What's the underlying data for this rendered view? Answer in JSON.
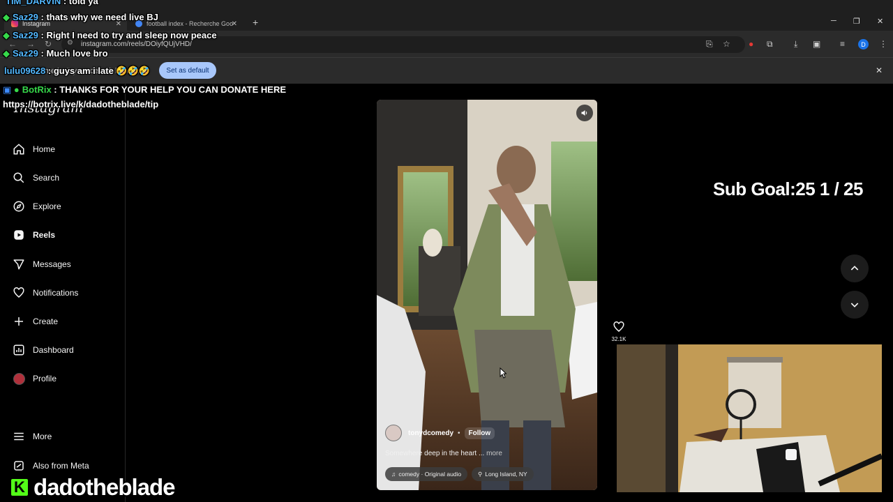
{
  "browser": {
    "tabs": [
      {
        "title": "Instagram",
        "active": true
      },
      {
        "title": "football index - Recherche Goo",
        "active": false
      }
    ],
    "new_tab": "+",
    "url": "instagram.com/reels/DOiyfQUjVHD/",
    "profile_initial": "D",
    "infobar": {
      "text": "Chrome isn't your default browser",
      "button": "Set as default",
      "close": "✕"
    },
    "window_controls": [
      "─",
      "❐",
      "✕"
    ]
  },
  "instagram": {
    "logo": "Instagram",
    "nav": [
      {
        "label": "Home",
        "icon": "home-icon"
      },
      {
        "label": "Search",
        "icon": "search-icon"
      },
      {
        "label": "Explore",
        "icon": "compass-icon"
      },
      {
        "label": "Reels",
        "icon": "reels-icon",
        "active": true
      },
      {
        "label": "Messages",
        "icon": "messages-icon"
      },
      {
        "label": "Notifications",
        "icon": "heart-icon"
      },
      {
        "label": "Create",
        "icon": "plus-icon"
      },
      {
        "label": "Dashboard",
        "icon": "dashboard-icon"
      },
      {
        "label": "Profile",
        "icon": "avatar"
      },
      {
        "label": "More",
        "icon": "menu-icon"
      },
      {
        "label": "Also from Meta",
        "icon": "meta-icon"
      }
    ],
    "reel": {
      "author": "tonydcomedy",
      "separator": "•",
      "follow": "Follow",
      "caption": "Somewhere deep in the heart ...",
      "caption_more": "more",
      "audio": "comedy · Original audio",
      "location": "Long Island, NY",
      "like_count": "32.1K"
    }
  },
  "overlay": {
    "chat": [
      {
        "user": "TIM_DARVIN",
        "message": ": told ya",
        "badge": false
      },
      {
        "user": "Saz29",
        "message": ": thats why we need live BJ",
        "badge": true
      },
      {
        "user": "Saz29",
        "message": ": Right I need to try and sleep now peace",
        "badge": true
      },
      {
        "user": "Saz29",
        "message": ": Much love bro",
        "badge": true
      },
      {
        "user": "lulu09628",
        "message": ": guys am i late 🤣🤣🤣",
        "badge": false
      },
      {
        "user": "BotRix",
        "message": ": THANKS FOR YOUR HELP YOU CAN DONATE HERE",
        "badge": true
      },
      {
        "user": "",
        "message": "https://botrix.live/k/dadotheblade/tip",
        "badge": false
      }
    ],
    "sub_goal": "Sub Goal:25  1 / 25",
    "channel": "dadotheblade",
    "kick_letter": "K"
  },
  "colors": {
    "chat_user": "#53b8ff",
    "kick_green": "#53fc18",
    "chrome_accent": "#a8c7fa"
  }
}
